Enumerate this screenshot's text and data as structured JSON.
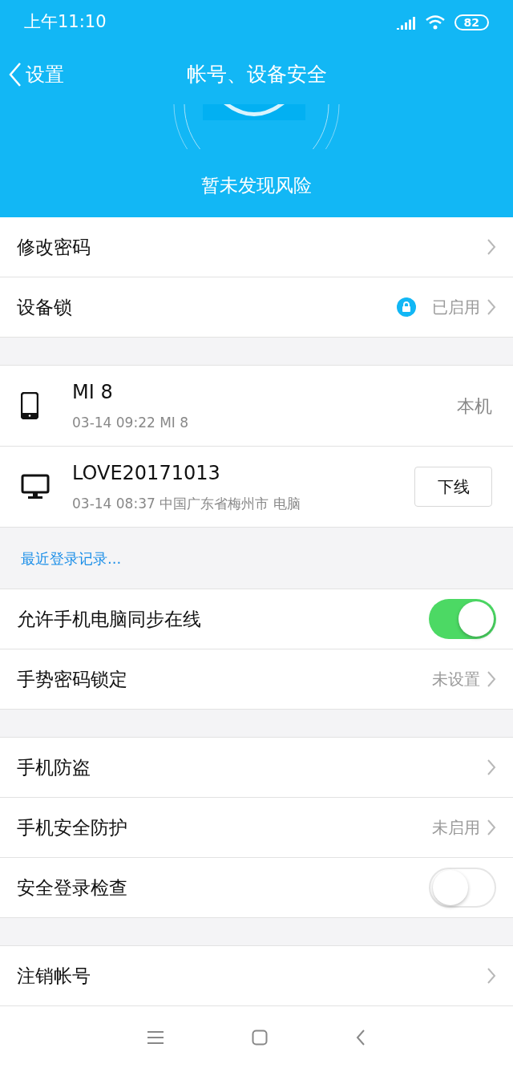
{
  "status_bar": {
    "time": "上午11:10",
    "battery": "82"
  },
  "nav": {
    "back": "设置",
    "title": "帐号、设备安全"
  },
  "header": {
    "status": "暂未发现风险"
  },
  "groups": [
    {
      "rows": [
        {
          "kind": "link",
          "label": "修改密码"
        },
        {
          "kind": "link",
          "label": "设备锁",
          "value": "已启用",
          "locked": true
        }
      ]
    },
    {
      "devices": [
        {
          "kind": "phone",
          "name": "MI 8",
          "detail": "03-14 09:22 MI 8",
          "note": "本机"
        },
        {
          "kind": "desktop",
          "name": "LOVE20171013",
          "detail": "03-14 08:37 中国广东省梅州市 电脑",
          "action": "下线"
        }
      ],
      "footer_link": "最近登录记录..."
    },
    {
      "rows": [
        {
          "kind": "toggle",
          "label": "允许手机电脑同步在线",
          "on": true
        },
        {
          "kind": "link",
          "label": "手势密码锁定",
          "value": "未设置"
        }
      ]
    },
    {
      "rows": [
        {
          "kind": "link",
          "label": "手机防盗"
        },
        {
          "kind": "link",
          "label": "手机安全防护",
          "value": "未启用"
        },
        {
          "kind": "toggle",
          "label": "安全登录检查",
          "on": false
        }
      ]
    },
    {
      "rows": [
        {
          "kind": "link",
          "label": "注销帐号"
        }
      ]
    }
  ]
}
